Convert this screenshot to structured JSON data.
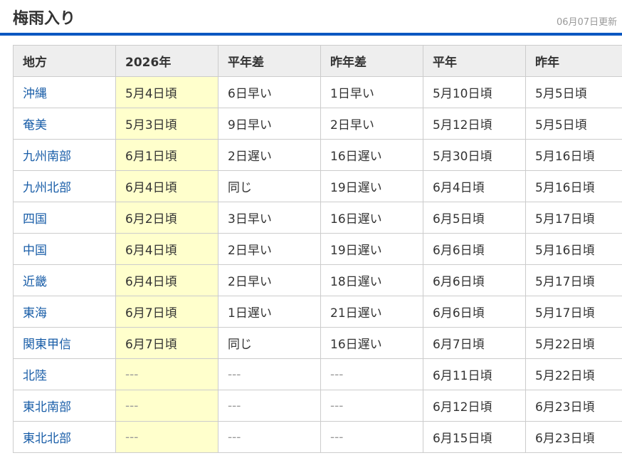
{
  "header": {
    "title": "梅雨入り",
    "updated": "06月07日更新"
  },
  "table": {
    "columns": [
      "地方",
      "2026年",
      "平年差",
      "昨年差",
      "平年",
      "昨年"
    ],
    "rows": [
      [
        "沖縄",
        "5月4日頃",
        "6日早い",
        "1日早い",
        "5月10日頃",
        "5月5日頃"
      ],
      [
        "奄美",
        "5月3日頃",
        "9日早い",
        "2日早い",
        "5月12日頃",
        "5月5日頃"
      ],
      [
        "九州南部",
        "6月1日頃",
        "2日遅い",
        "16日遅い",
        "5月30日頃",
        "5月16日頃"
      ],
      [
        "九州北部",
        "6月4日頃",
        "同じ",
        "19日遅い",
        "6月4日頃",
        "5月16日頃"
      ],
      [
        "四国",
        "6月2日頃",
        "3日早い",
        "16日遅い",
        "6月5日頃",
        "5月17日頃"
      ],
      [
        "中国",
        "6月4日頃",
        "2日早い",
        "19日遅い",
        "6月6日頃",
        "5月16日頃"
      ],
      [
        "近畿",
        "6月4日頃",
        "2日早い",
        "18日遅い",
        "6月6日頃",
        "5月17日頃"
      ],
      [
        "東海",
        "6月7日頃",
        "1日遅い",
        "21日遅い",
        "6月6日頃",
        "5月17日頃"
      ],
      [
        "関東甲信",
        "6月7日頃",
        "同じ",
        "16日遅い",
        "6月7日頃",
        "5月22日頃"
      ],
      [
        "北陸",
        "---",
        "---",
        "---",
        "6月11日頃",
        "5月22日頃"
      ],
      [
        "東北南部",
        "---",
        "---",
        "---",
        "6月12日頃",
        "6月23日頃"
      ],
      [
        "東北北部",
        "---",
        "---",
        "---",
        "6月15日頃",
        "6月23日頃"
      ]
    ]
  },
  "colors": {
    "accent": "#0b57c1",
    "link": "#1a5ea8",
    "highlight": "#ffffcc",
    "header_bg": "#eeeeee"
  }
}
